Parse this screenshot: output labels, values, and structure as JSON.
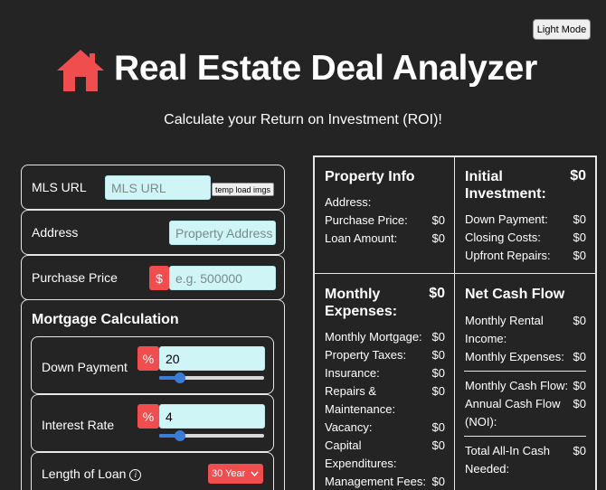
{
  "theme_toggle": "Light Mode",
  "header": {
    "icon": "house-icon",
    "title": "Real Estate Deal Analyzer",
    "subtitle": "Calculate your Return on Investment (ROI)!"
  },
  "colors": {
    "accent": "#f04e4e",
    "input_bg": "#cff5f7",
    "background": "#242424",
    "slider": "#3a7bd5"
  },
  "form": {
    "mls": {
      "label": "MLS URL",
      "placeholder": "MLS URL",
      "button": "temp load imgs"
    },
    "address": {
      "label": "Address",
      "placeholder": "Property Address"
    },
    "purchase_price": {
      "label": "Purchase Price",
      "prefix": "$",
      "placeholder": "e.g. 500000"
    },
    "mortgage": {
      "title": "Mortgage Calculation",
      "down_payment": {
        "label": "Down Payment",
        "prefix": "%",
        "value": "20",
        "slider_fraction": 0.2
      },
      "interest_rate": {
        "label": "Interest Rate",
        "prefix": "%",
        "value": "4",
        "slider_fraction": 0.2
      },
      "loan_length": {
        "label": "Length of Loan",
        "selected": "30 Year"
      }
    }
  },
  "results": {
    "property_info": {
      "title": "Property Info",
      "rows": [
        {
          "label": "Address:",
          "value": ""
        },
        {
          "label": "Purchase Price:",
          "value": "$0"
        },
        {
          "label": "Loan Amount:",
          "value": "$0"
        }
      ]
    },
    "initial_investment": {
      "title_line1": "Initial",
      "title_line2": "Investment:",
      "total": "$0",
      "rows": [
        {
          "label": "Down Payment:",
          "value": "$0"
        },
        {
          "label": "Closing Costs:",
          "value": "$0"
        },
        {
          "label": "Upfront Repairs:",
          "value": "$0"
        }
      ]
    },
    "monthly_expenses": {
      "title_line1": "Monthly",
      "title_line2": "Expenses:",
      "total": "$0",
      "rows": [
        {
          "label": "Monthly Mortgage:",
          "value": "$0"
        },
        {
          "label": "Property Taxes:",
          "value": "$0"
        },
        {
          "label": "Insurance:",
          "value": "$0"
        },
        {
          "label": "Repairs &",
          "label2": "Maintenance:",
          "value": "$0"
        },
        {
          "label": "Vacancy:",
          "value": "$0"
        },
        {
          "label": "Capital",
          "label2": "Expenditures:",
          "value": "$0"
        },
        {
          "label": "Management Fees:",
          "value": "$0"
        }
      ]
    },
    "net_cash_flow": {
      "title": "Net Cash Flow",
      "rental_income_line1": "Monthly Rental",
      "rental_income_line2": "Income:",
      "rental_income_value": "$0",
      "monthly_expenses_label": "Monthly Expenses:",
      "monthly_expenses_value": "$0",
      "monthly_cash_flow_label": "Monthly Cash Flow:",
      "monthly_cash_flow_value": "$0",
      "annual_line1": "Annual Cash Flow",
      "annual_line2": "(NOI):",
      "annual_value": "$0",
      "all_in_line1": "Total All-In Cash",
      "all_in_line2": "Needed:",
      "all_in_value": "$0"
    }
  }
}
